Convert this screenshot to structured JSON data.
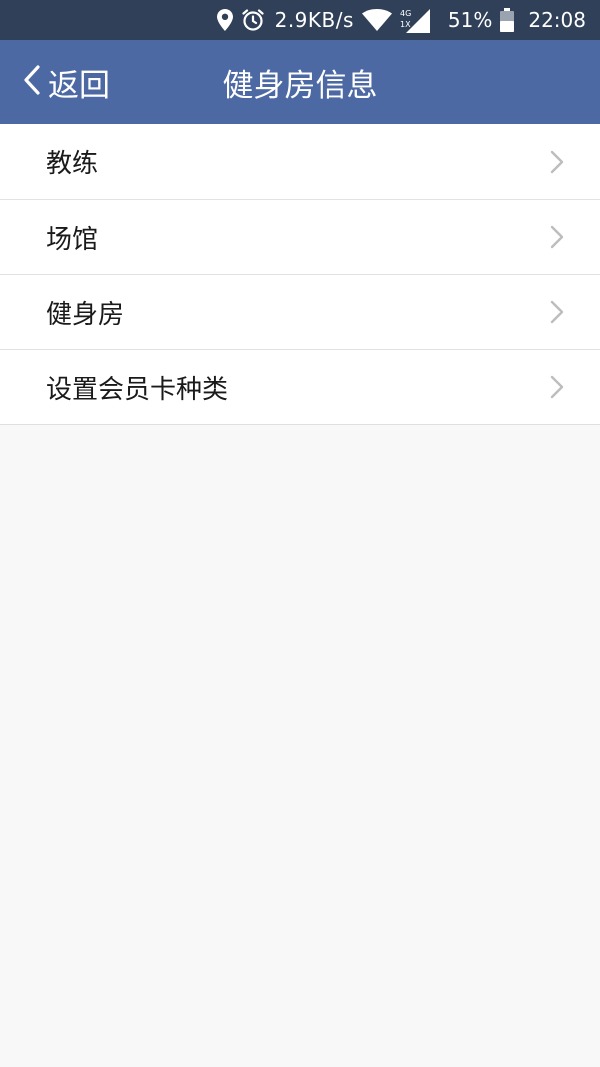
{
  "status_bar": {
    "speed": "2.9KB/s",
    "network_top": "4G",
    "network_bottom": "1X",
    "battery": "51%",
    "time": "22:08",
    "icons": [
      "location-icon",
      "alarm-icon",
      "wifi-icon",
      "signal-icon",
      "battery-icon"
    ]
  },
  "nav": {
    "back_label": "返回",
    "title": "健身房信息",
    "background": "#4c69a4"
  },
  "menu": {
    "items": [
      {
        "label": "教练"
      },
      {
        "label": "场馆"
      },
      {
        "label": "健身房"
      },
      {
        "label": "设置会员卡种类"
      }
    ]
  }
}
